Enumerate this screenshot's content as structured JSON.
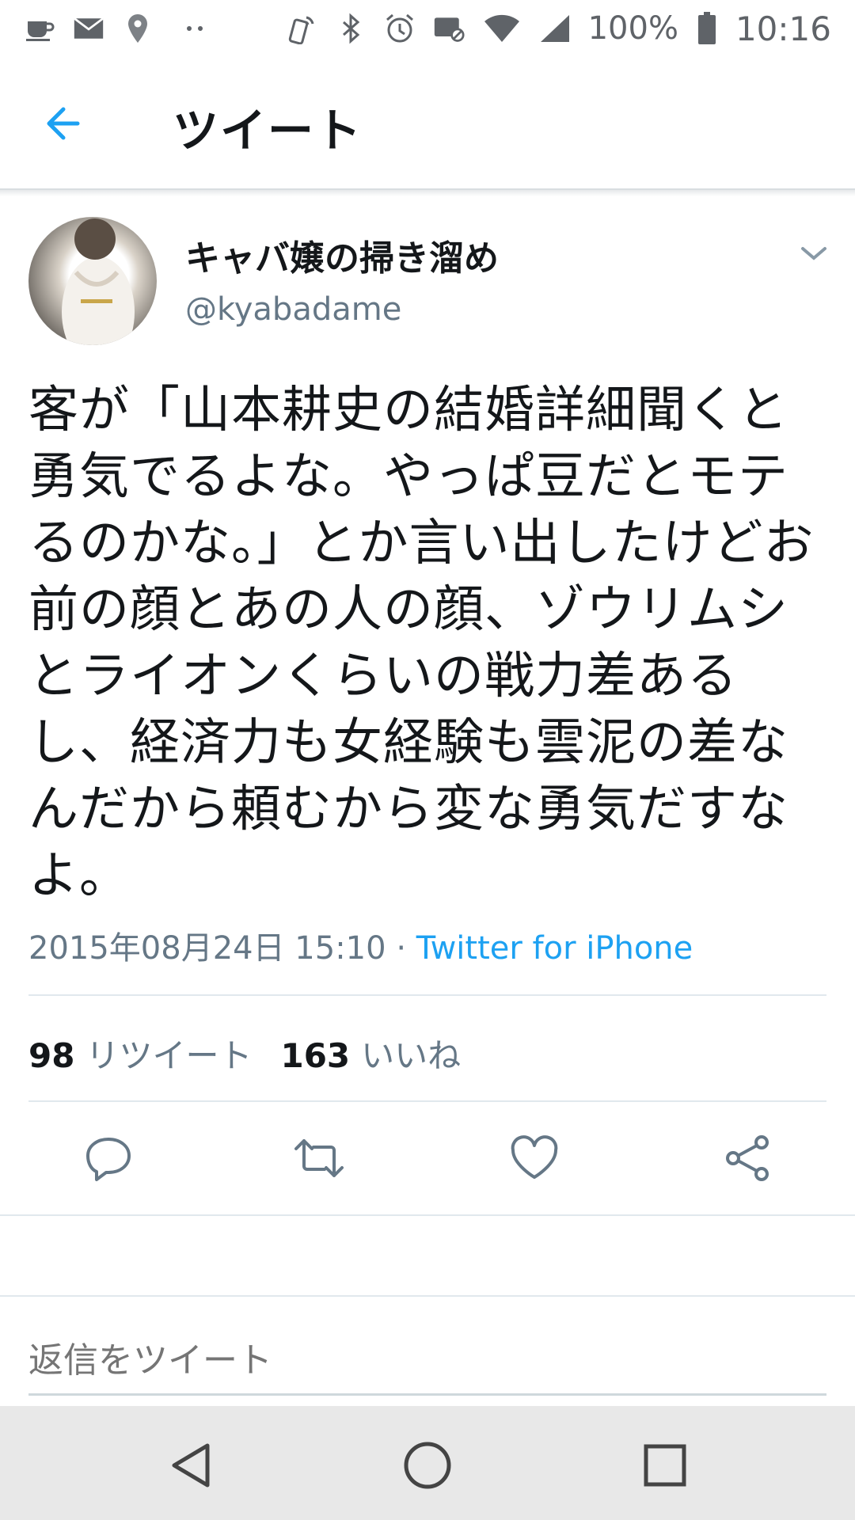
{
  "status_bar": {
    "battery": "100%",
    "time": "10:16",
    "left_icons": [
      "cup-icon",
      "mail-icon",
      "location-icon",
      "dots-icon"
    ],
    "right_icons": [
      "nfc-icon",
      "bluetooth-icon",
      "alarm-icon",
      "vibrate-icon",
      "wifi-icon",
      "signal-icon",
      "battery-icon"
    ]
  },
  "header": {
    "title": "ツイート"
  },
  "tweet": {
    "display_name": "キャバ嬢の掃き溜め",
    "handle": "@kyabadame",
    "text": "客が「山本耕史の結婚詳細聞くと勇気でるよな。やっぱ豆だとモテるのかな。」とか言い出したけどお前の顔とあの人の顔、ゾウリムシとライオンくらいの戦力差あるし、経済力も女経験も雲泥の差なんだから頼むから変な勇気だすなよ。",
    "timestamp": "2015年08月24日 15:10",
    "separator": "·",
    "source": "Twitter for iPhone"
  },
  "stats": {
    "retweets_count": "98",
    "retweets_label": "リツイート",
    "likes_count": "163",
    "likes_label": "いいね"
  },
  "reply": {
    "placeholder": "返信をツイート"
  },
  "colors": {
    "accent": "#1da1f2",
    "muted": "#657786",
    "text": "#14171a"
  }
}
